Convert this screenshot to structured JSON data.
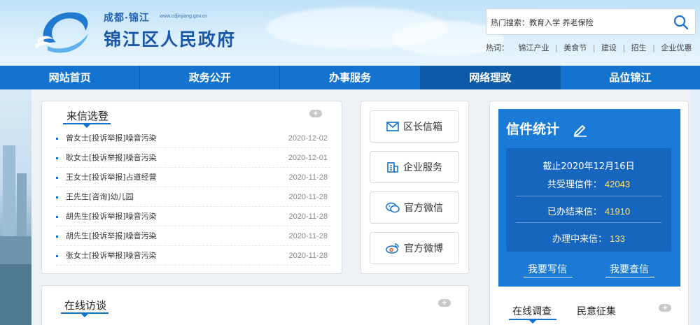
{
  "header": {
    "site_sub": "成都·锦江",
    "site_url": "www.cdjinjiang.gov.cn",
    "site_title": "锦江区人民政府"
  },
  "search": {
    "hot_search_label": "热门搜索：",
    "hot_search_terms": "教育入学 养老保险",
    "hot_words_label": "热词：",
    "hot_words": [
      "锦江产业",
      "美食节",
      "建设",
      "招生",
      "企业优惠"
    ]
  },
  "nav": {
    "items": [
      "网站首页",
      "政务公开",
      "办事服务",
      "网络理政",
      "品位锦江"
    ],
    "active_index": 3
  },
  "letters": {
    "title": "来信选登",
    "more": "+",
    "items": [
      {
        "title": "曾女士[投诉举报]噪音污染",
        "date": "2020-12-02"
      },
      {
        "title": "耿女士[投诉举报]噪音污染",
        "date": "2020-12-01"
      },
      {
        "title": "王女士[投诉举报]占道经营",
        "date": "2020-11-28"
      },
      {
        "title": "王先生[咨询]幼儿园",
        "date": "2020-11-28"
      },
      {
        "title": "胡先生[投诉举报]噪音污染",
        "date": "2020-11-28"
      },
      {
        "title": "胡先生[投诉举报]噪音污染",
        "date": "2020-11-28"
      },
      {
        "title": "张女士[投诉举报]噪音污染",
        "date": "2020-11-28"
      }
    ]
  },
  "services": {
    "mayor_mailbox": "区长信箱",
    "enterprise_service": "企业服务",
    "official_wechat": "官方微信",
    "official_weibo": "官方微博"
  },
  "stats": {
    "title": "信件统计",
    "as_of": "截止2020年12月16日",
    "total_label": "共受理信件：",
    "total_value": "42043",
    "done_label": "已办结来信：",
    "done_value": "41910",
    "pending_label": "办理中来信：",
    "pending_value": "133",
    "write_link": "我要写信",
    "query_link": "我要查信"
  },
  "interview": {
    "title": "在线访谈",
    "more": "+"
  },
  "survey": {
    "tab_survey": "在线调查",
    "tab_opinion": "民意征集",
    "more": "+"
  },
  "colors": {
    "nav_blue": "#1473cf",
    "nav_active": "#0d5aa8",
    "stats_bg": "#1a7ad6",
    "stats_number": "#ffe066"
  }
}
